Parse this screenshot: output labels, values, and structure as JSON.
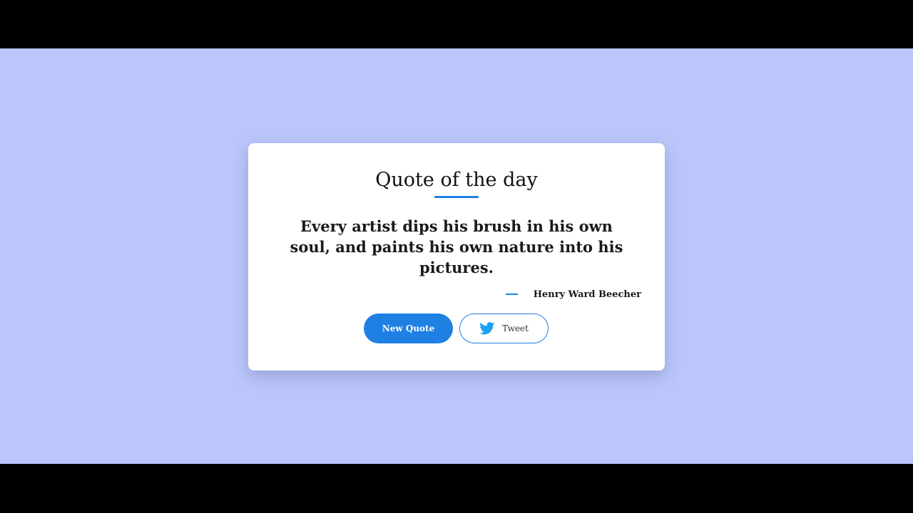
{
  "card": {
    "title": "Quote of the day",
    "quote": "Every artist dips his brush in his own soul, and paints his own nature into his pictures.",
    "author": "Henry Ward Beecher"
  },
  "buttons": {
    "new_quote_label": "New Quote",
    "tweet_label": "Tweet",
    "tweet_icon": "twitter-bird-icon"
  },
  "colors": {
    "background": "#bbc7fa",
    "accent": "#1f80e4",
    "twitter_blue": "#1da1f2",
    "card": "#ffffff"
  }
}
